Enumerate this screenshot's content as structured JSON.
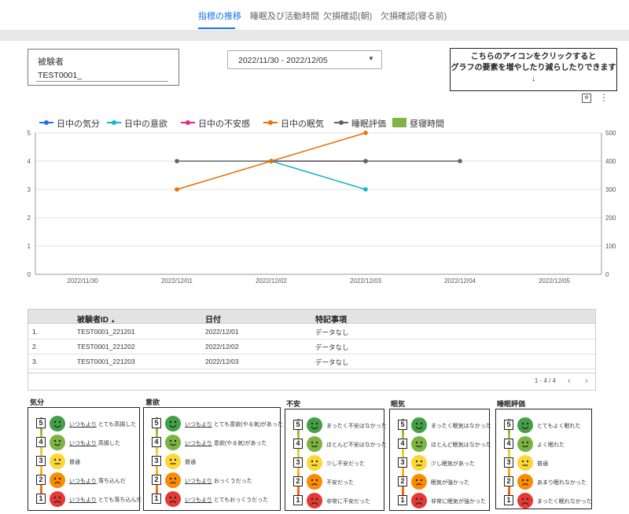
{
  "tabs": [
    {
      "label": "指標の推移",
      "active": true
    },
    {
      "label": "睡眠及び活動時間",
      "active": false
    },
    {
      "label": "欠損確認(朝)",
      "active": false
    },
    {
      "label": "欠損確認(寝る前)",
      "active": false
    }
  ],
  "subject": {
    "label": "被験者",
    "value": "TEST0001_"
  },
  "date_range": {
    "value": "2022/11/30 - 2022/12/05"
  },
  "note": {
    "line1": "こちらのアイコンをクリックすると",
    "line2": "グラフの要素を増やしたり減らしたりできます",
    "arrow": "↓"
  },
  "icons": {
    "chart_settings": "chart-edit-icon",
    "more": "more-vert-icon"
  },
  "chart_data": {
    "type": "line",
    "legend": [
      {
        "name": "日中の気分",
        "color": "#1a73e8",
        "kind": "line"
      },
      {
        "name": "日中の意欲",
        "color": "#12b5cb",
        "kind": "line"
      },
      {
        "name": "日中の不安感",
        "color": "#e52592",
        "kind": "line"
      },
      {
        "name": "日中の眠気",
        "color": "#e8710a",
        "kind": "line"
      },
      {
        "name": "睡眠評価",
        "color": "#5f6368",
        "kind": "line"
      },
      {
        "name": "昼寝時間",
        "color": "#7cb342",
        "kind": "bar"
      }
    ],
    "categories": [
      "2022/11/30",
      "2022/12/01",
      "2022/12/02",
      "2022/12/03",
      "2022/12/04",
      "2022/12/05"
    ],
    "y_left": {
      "min": 0,
      "max": 5,
      "ticks": [
        "0",
        "1",
        "2",
        "3",
        "4",
        "5"
      ]
    },
    "y_right": {
      "min": 0,
      "max": 500,
      "ticks": [
        "0",
        "100",
        "200",
        "300",
        "400",
        "500"
      ]
    },
    "series": [
      {
        "name": "日中の意欲",
        "color": "#12b5cb",
        "values": [
          null,
          null,
          4,
          3,
          null,
          null
        ]
      },
      {
        "name": "日中の不安感",
        "color": "#e52592",
        "values": [
          null,
          null,
          4,
          4,
          null,
          null
        ]
      },
      {
        "name": "睡眠評価",
        "color": "#5f6368",
        "values": [
          null,
          4,
          4,
          4,
          4,
          null
        ]
      },
      {
        "name": "日中の眠気",
        "color": "#e8710a",
        "values": [
          null,
          3,
          4,
          5,
          null,
          null
        ]
      }
    ]
  },
  "table": {
    "headers": [
      "被験者ID",
      "日付",
      "特記事項"
    ],
    "sort_indicator": "▲",
    "rows": [
      {
        "num": "1.",
        "id": "TEST0001_221201",
        "date": "2022/12/01",
        "note": "データなし"
      },
      {
        "num": "2.",
        "id": "TEST0001_221202",
        "date": "2022/12/02",
        "note": "データなし"
      },
      {
        "num": "3.",
        "id": "TEST0001_221203",
        "date": "2022/12/03",
        "note": "データなし"
      }
    ],
    "pagination": "1 - 4 / 4",
    "prev": "‹",
    "next": "›"
  },
  "legends_panels": [
    {
      "title": "気分",
      "items": [
        {
          "n": "5",
          "prefix": "いつもより",
          "text": "とても高揚した"
        },
        {
          "n": "4",
          "prefix": "いつもより",
          "text": "高揚した"
        },
        {
          "n": "3",
          "prefix": "",
          "text": "普通"
        },
        {
          "n": "2",
          "prefix": "いつもより",
          "text": "落ち込んだ"
        },
        {
          "n": "1",
          "prefix": "いつもより",
          "text": "とても落ち込んだ"
        }
      ]
    },
    {
      "title": "意欲",
      "items": [
        {
          "n": "5",
          "prefix": "いつもより",
          "text": "とても意欲(やる気)があった"
        },
        {
          "n": "4",
          "prefix": "いつもより",
          "text": "意欲(やる気)があった"
        },
        {
          "n": "3",
          "prefix": "",
          "text": "普通"
        },
        {
          "n": "2",
          "prefix": "いつもより",
          "text": "おっくうだった"
        },
        {
          "n": "1",
          "prefix": "いつもより",
          "text": "とてもおっくうだった"
        }
      ]
    },
    {
      "title": "不安",
      "items": [
        {
          "n": "5",
          "prefix": "",
          "text": "まったく不安はなかった"
        },
        {
          "n": "4",
          "prefix": "",
          "text": "ほとんど不安はなかった"
        },
        {
          "n": "3",
          "prefix": "",
          "text": "少し不安だった"
        },
        {
          "n": "2",
          "prefix": "",
          "text": "不安だった"
        },
        {
          "n": "1",
          "prefix": "",
          "text": "非常に不安だった"
        }
      ]
    },
    {
      "title": "眠気",
      "items": [
        {
          "n": "5",
          "prefix": "",
          "text": "まったく眠気はなかった"
        },
        {
          "n": "4",
          "prefix": "",
          "text": "ほとんど眠気はなかった"
        },
        {
          "n": "3",
          "prefix": "",
          "text": "少し眠気があった"
        },
        {
          "n": "2",
          "prefix": "",
          "text": "眠気が強かった"
        },
        {
          "n": "1",
          "prefix": "",
          "text": "非常に眠気が強かった"
        }
      ]
    },
    {
      "title": "睡眠評価",
      "items": [
        {
          "n": "5",
          "prefix": "",
          "text": "とてもよく眠れた"
        },
        {
          "n": "4",
          "prefix": "",
          "text": "よく眠れた"
        },
        {
          "n": "3",
          "prefix": "",
          "text": "普通"
        },
        {
          "n": "2",
          "prefix": "",
          "text": "あまり眠れなかった"
        },
        {
          "n": "1",
          "prefix": "",
          "text": "まったく眠れなかった"
        }
      ]
    }
  ]
}
